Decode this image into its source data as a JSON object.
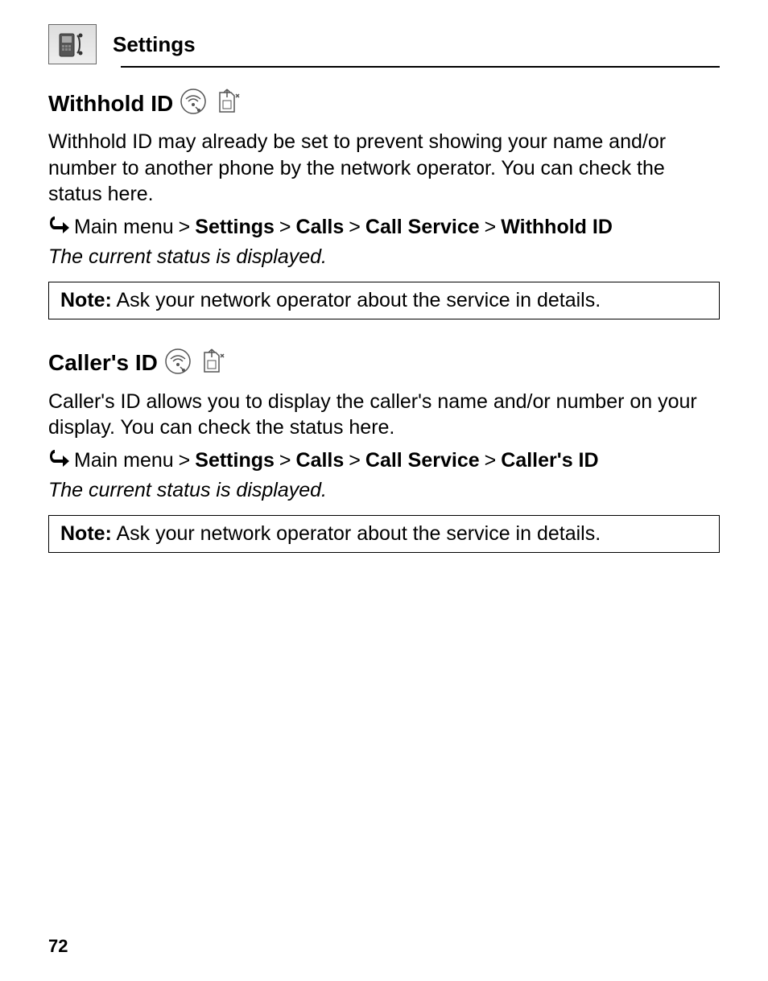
{
  "header": {
    "title": "Settings"
  },
  "section1": {
    "heading": "Withhold ID",
    "body": "Withhold ID may already be set to prevent showing your name and/or number to another phone by the network operator. You can check the status here.",
    "breadcrumb": {
      "prefix": "Main menu",
      "sep": ">",
      "p1": "Settings",
      "p2": "Calls",
      "p3": "Call Service",
      "p4": "Withhold ID"
    },
    "status": "The current status is displayed.",
    "note_label": "Note:",
    "note_text": " Ask your network operator about the service in details."
  },
  "section2": {
    "heading": "Caller's ID",
    "body": "Caller's ID allows you to display the caller's name and/or number on your display. You can check the status here.",
    "breadcrumb": {
      "prefix": "Main menu",
      "sep": ">",
      "p1": "Settings",
      "p2": "Calls",
      "p3": "Call Service",
      "p4": "Caller's ID"
    },
    "status": "The current status is displayed.",
    "note_label": "Note:",
    "note_text": " Ask your network operator about the service in details."
  },
  "page_number": "72"
}
